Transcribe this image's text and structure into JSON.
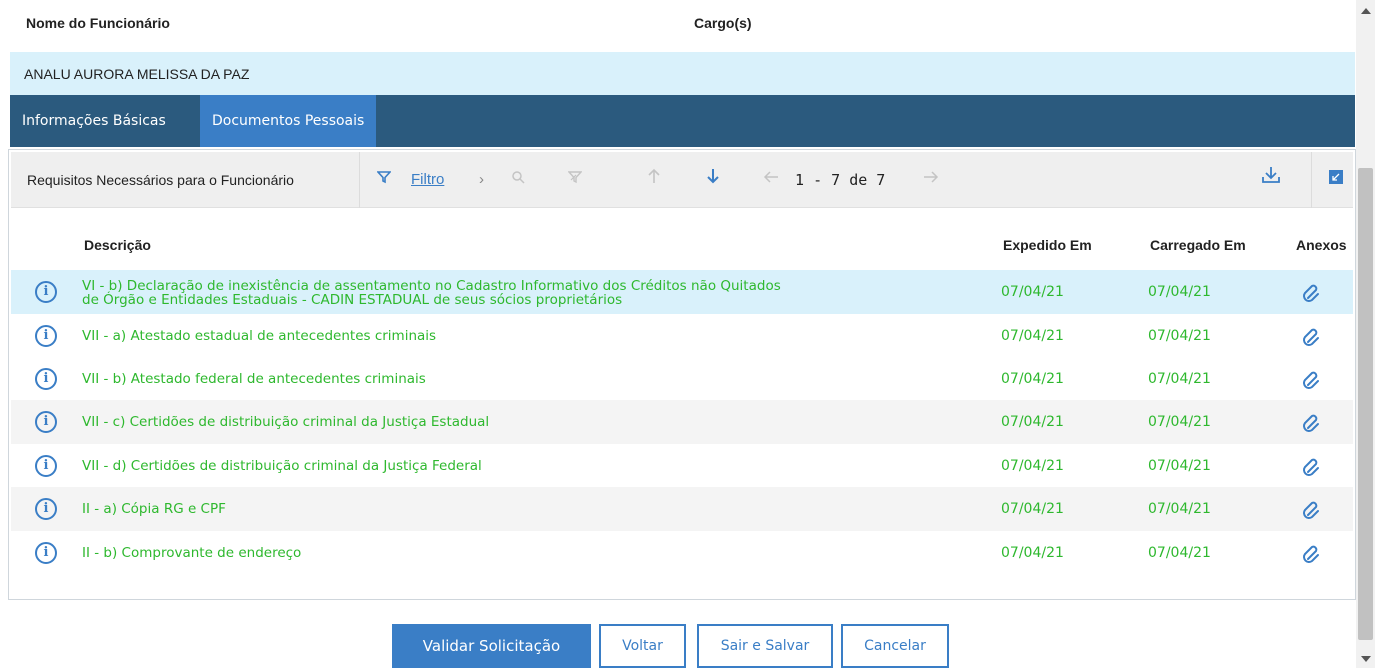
{
  "header": {
    "col_name": "Nome do Funcionário",
    "col_role": "Cargo(s)"
  },
  "employee": {
    "name": "ANALU AURORA MELISSA DA PAZ"
  },
  "tabs": [
    {
      "label": "Informações Básicas",
      "active": false
    },
    {
      "label": "Documentos Pessoais",
      "active": true
    }
  ],
  "toolbar": {
    "title": "Requisitos Necessários para o Funcionário",
    "filter_label": "Filtro",
    "pager": {
      "from": "1",
      "dash": "-",
      "to": "7",
      "de": "de",
      "total": "7"
    }
  },
  "table": {
    "headers": {
      "description": "Descrição",
      "issued": "Expedido Em",
      "uploaded": "Carregado Em",
      "attachments": "Anexos"
    },
    "rows": [
      {
        "desc1": "VI - b) Declaração de inexistência de assentamento no Cadastro Informativo dos Créditos não Quitados",
        "desc2": "de Órgão e Entidades Estaduais - CADIN ESTADUAL de seus sócios proprietários",
        "issued": "07/04/21",
        "uploaded": "07/04/21"
      },
      {
        "desc1": "VII - a) Atestado estadual de antecedentes criminais",
        "issued": "07/04/21",
        "uploaded": "07/04/21"
      },
      {
        "desc1": "VII - b) Atestado federal de antecedentes criminais",
        "issued": "07/04/21",
        "uploaded": "07/04/21"
      },
      {
        "desc1": "VII - c) Certidões de distribuição criminal da Justiça Estadual",
        "issued": "07/04/21",
        "uploaded": "07/04/21"
      },
      {
        "desc1": "VII - d) Certidões de distribuição criminal da Justiça Federal",
        "issued": "07/04/21",
        "uploaded": "07/04/21"
      },
      {
        "desc1": "II - a) Cópia RG e CPF",
        "issued": "07/04/21",
        "uploaded": "07/04/21"
      },
      {
        "desc1": "II - b) Comprovante de endereço",
        "issued": "07/04/21",
        "uploaded": "07/04/21"
      }
    ]
  },
  "buttons": {
    "validate": "Validar Solicitação",
    "back": "Voltar",
    "save_exit": "Sair e Salvar",
    "cancel": "Cancelar"
  },
  "colors": {
    "accent": "#3a7ec6",
    "tabbar": "#2b5a7e",
    "row_text": "#2eb82e",
    "selected_row": "#d9f1fb"
  },
  "icons": [
    "info-icon",
    "paperclip-icon",
    "filter-icon",
    "search-icon",
    "clear-filter-icon",
    "arrow-up-icon",
    "arrow-down-icon",
    "arrow-left-icon",
    "arrow-right-icon",
    "download-icon",
    "collapse-icon"
  ]
}
